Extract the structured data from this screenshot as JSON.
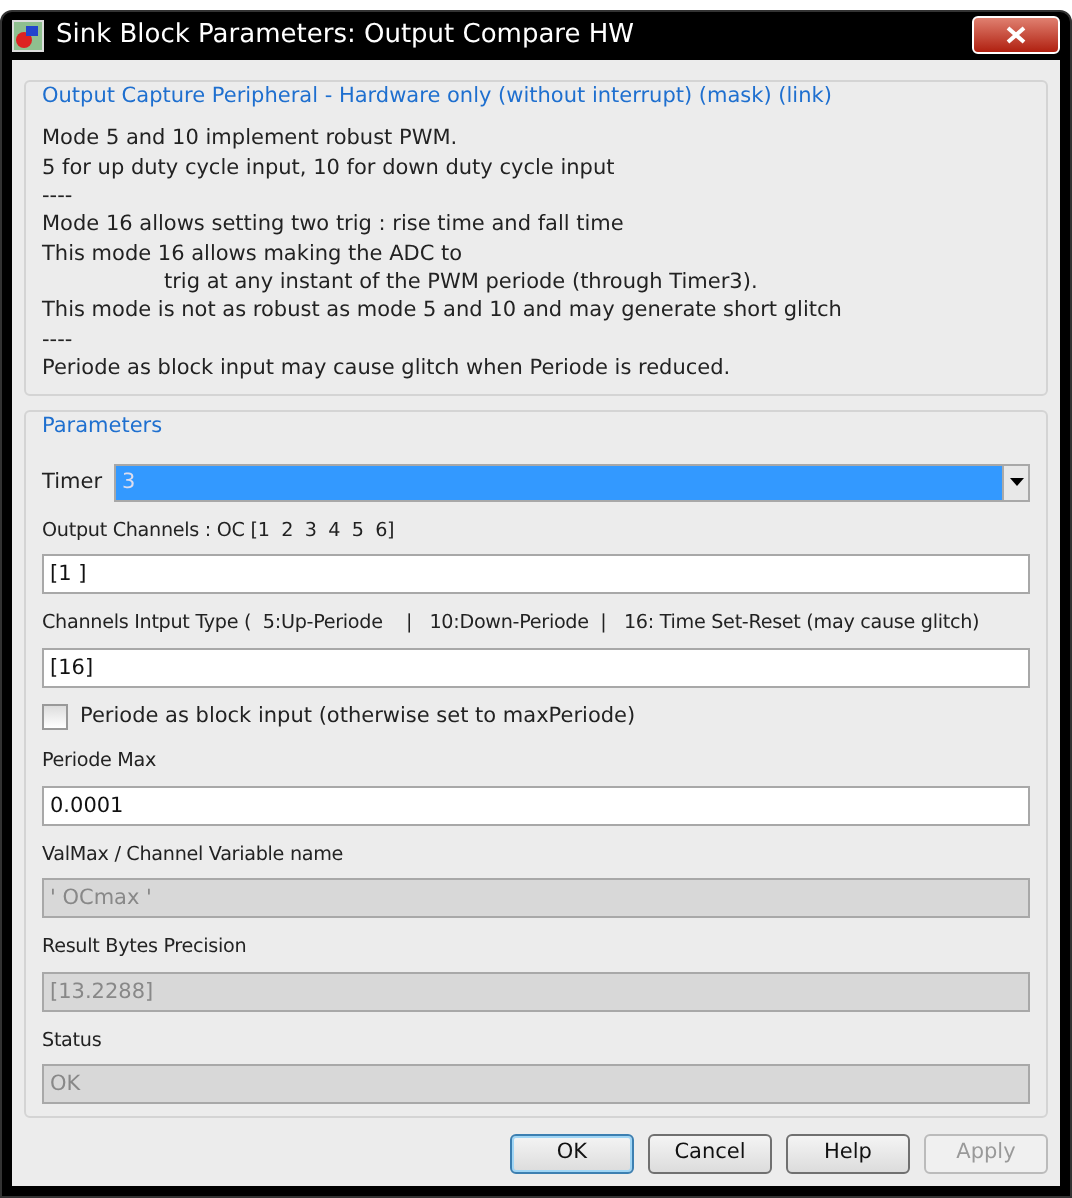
{
  "window": {
    "title": "Sink Block Parameters: Output Compare HW"
  },
  "description": {
    "title": "Output Capture Peripheral - Hardware only (without interrupt)  (mask) (link)",
    "lines": [
      {
        "text": "Mode 5 and 10 implement robust PWM.",
        "indented": false
      },
      {
        "text": "5 for up duty cycle input, 10 for down duty cycle input",
        "indented": false
      },
      {
        "text": "----",
        "indented": false
      },
      {
        "text": "Mode 16 allows setting two trig : rise time and fall time",
        "indented": false
      },
      {
        "text": "This mode 16 allows making the ADC to",
        "indented": false
      },
      {
        "text": "trig at any instant of the PWM periode (through Timer3).",
        "indented": true
      },
      {
        "text": "This mode is not as robust as mode 5 and 10 and may generate short glitch",
        "indented": false
      },
      {
        "text": "----",
        "indented": false
      },
      {
        "text": "Periode as block input may cause glitch when Periode is reduced.",
        "indented": false
      }
    ]
  },
  "parameters": {
    "title": "Parameters",
    "items": [
      {
        "kind": "select",
        "label": "Timer",
        "value": "3",
        "selected": true
      },
      {
        "kind": "text",
        "label": "Output Channels : OC [1  2  3  4  5  6]",
        "value": "[1 ]",
        "disabled": false
      },
      {
        "kind": "text",
        "label": "Channels Intput Type (  5:Up-Periode    |   10:Down-Periode  |   16: Time Set-Reset (may cause glitch)",
        "value": "[16]",
        "disabled": false
      },
      {
        "kind": "checkbox",
        "label": "Periode as block input (otherwise set to maxPeriode)",
        "checked": false
      },
      {
        "kind": "text",
        "label": "Periode Max",
        "value": "0.0001",
        "disabled": false
      },
      {
        "kind": "text",
        "label": "ValMax / Channel Variable name",
        "value": "' OCmax '",
        "disabled": true
      },
      {
        "kind": "text",
        "label": "Result Bytes Precision",
        "value": "[13.2288]",
        "disabled": true
      },
      {
        "kind": "text",
        "label": "Status",
        "value": "OK",
        "disabled": true
      }
    ]
  },
  "buttons": [
    {
      "label": "OK",
      "default": true,
      "disabled": false
    },
    {
      "label": "Cancel",
      "default": false,
      "disabled": false
    },
    {
      "label": "Help",
      "default": false,
      "disabled": false
    },
    {
      "label": "Apply",
      "default": false,
      "disabled": true
    }
  ]
}
